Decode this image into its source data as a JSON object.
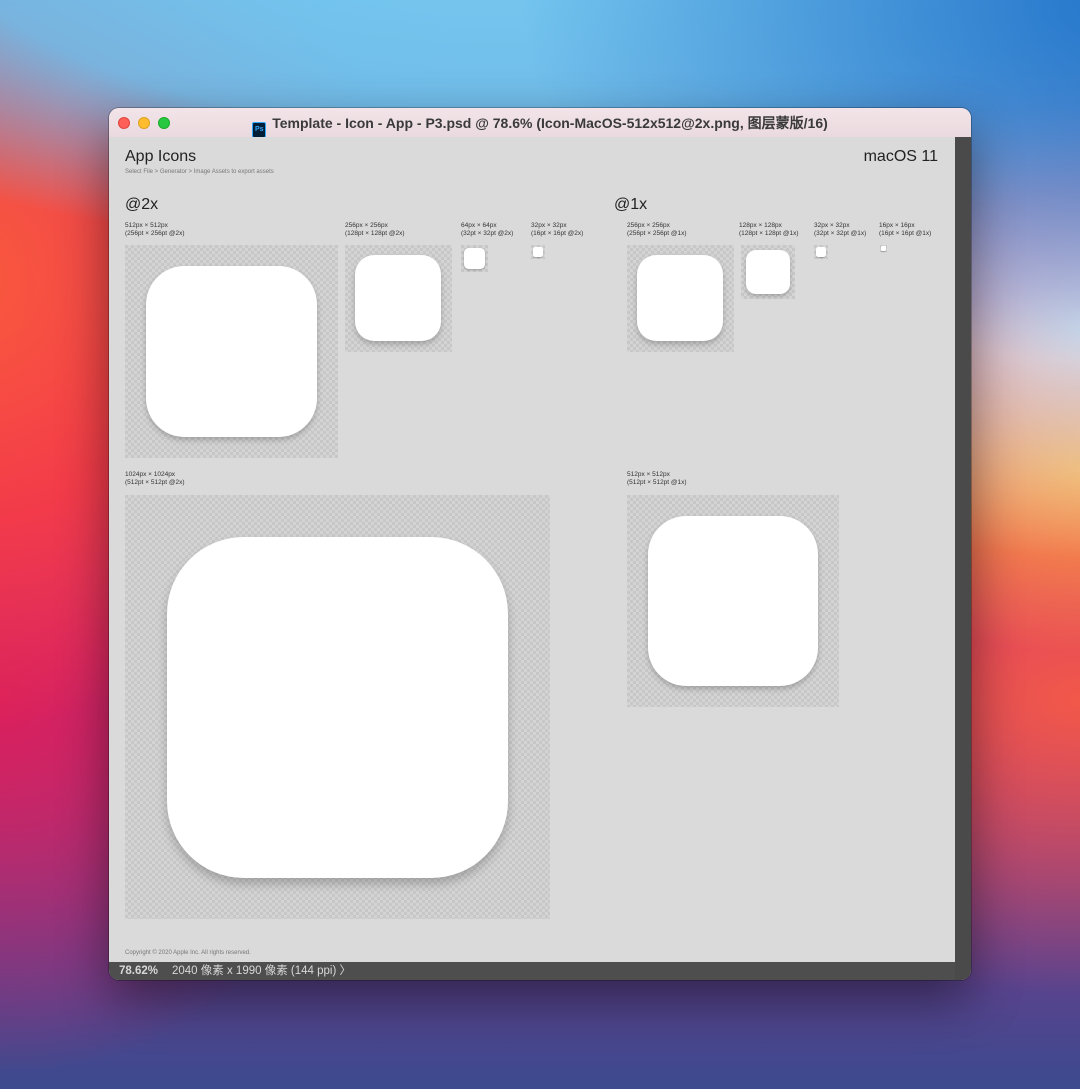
{
  "window": {
    "title": "Template - Icon - App - P3.psd @ 78.6% (Icon-MacOS-512x512@2x.png, 图层蒙版/16)",
    "app_icon_label": "Ps"
  },
  "document": {
    "heading": "App Icons",
    "subheading": "Select File > Generator > Image Assets to export assets",
    "platform": "macOS 11",
    "sections": {
      "at2x": {
        "title": "@2x",
        "labels": {
          "s512": [
            "512px × 512px",
            "(256pt × 256pt @2x)"
          ],
          "s256": [
            "256px × 256px",
            "(128pt × 128pt @2x)"
          ],
          "s64": [
            "64px × 64px",
            "(32pt × 32pt @2x)"
          ],
          "s32": [
            "32px × 32px",
            "(16pt × 16pt @2x)"
          ],
          "s1024": [
            "1024px × 1024px",
            "(512pt × 512pt @2x)"
          ]
        }
      },
      "at1x": {
        "title": "@1x",
        "labels": {
          "s256": [
            "256px × 256px",
            "(256pt × 256pt @1x)"
          ],
          "s128": [
            "128px × 128px",
            "(128pt × 128pt @1x)"
          ],
          "s32": [
            "32px × 32px",
            "(32pt × 32pt @1x)"
          ],
          "s16": [
            "16px × 16px",
            "(16pt × 16pt @1x)"
          ],
          "s512": [
            "512px × 512px",
            "(512pt × 512pt @1x)"
          ]
        }
      }
    },
    "copyright": "Copyright © 2020 Apple Inc. All rights reserved."
  },
  "status": {
    "zoom": "78.62%",
    "doc_info": "2040 像素 x 1990 像素 (144 ppi)",
    "arrow": "〉"
  }
}
